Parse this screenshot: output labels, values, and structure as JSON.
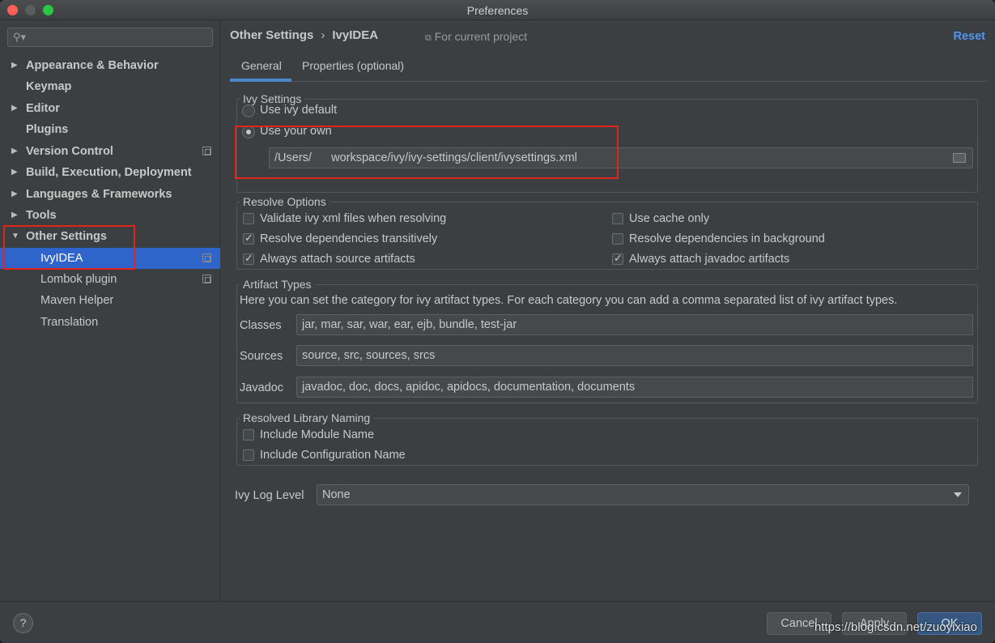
{
  "window": {
    "title": "Preferences"
  },
  "sidebar": {
    "search_placeholder": "",
    "items": [
      {
        "label": "Appearance & Behavior"
      },
      {
        "label": "Keymap"
      },
      {
        "label": "Editor"
      },
      {
        "label": "Plugins"
      },
      {
        "label": "Version Control"
      },
      {
        "label": "Build, Execution, Deployment"
      },
      {
        "label": "Languages & Frameworks"
      },
      {
        "label": "Tools"
      },
      {
        "label": "Other Settings"
      },
      {
        "label": "IvyIDEA"
      },
      {
        "label": "Lombok plugin"
      },
      {
        "label": "Maven Helper"
      },
      {
        "label": "Translation"
      }
    ]
  },
  "header": {
    "crumb_parent": "Other Settings",
    "crumb_sep": "›",
    "crumb_current": "IvyIDEA",
    "scope": "For current project",
    "reset": "Reset"
  },
  "tabs": [
    {
      "label": "General"
    },
    {
      "label": "Properties (optional)"
    }
  ],
  "ivy_settings": {
    "title": "Ivy Settings",
    "use_default": "Use ivy default",
    "use_own": "Use your own",
    "path": "/Users/   workspace/ivy/ivy-settings/client/ivysettings.xml"
  },
  "resolve_options": {
    "title": "Resolve Options",
    "validate": "Validate ivy xml files when resolving",
    "transitive": "Resolve dependencies transitively",
    "attach_source": "Always attach source artifacts",
    "cache_only": "Use cache only",
    "background": "Resolve dependencies in background",
    "attach_javadoc": "Always attach javadoc artifacts"
  },
  "artifact_types": {
    "title": "Artifact Types",
    "description": "Here you can set the category for ivy artifact types. For each category you can add a comma separated list of ivy artifact types.",
    "classes_label": "Classes",
    "classes_value": "jar, mar, sar, war, ear, ejb, bundle, test-jar",
    "sources_label": "Sources",
    "sources_value": "source, src, sources, srcs",
    "javadoc_label": "Javadoc",
    "javadoc_value": "javadoc, doc, docs, apidoc, apidocs, documentation, documents"
  },
  "library_naming": {
    "title": "Resolved Library Naming",
    "module": "Include Module Name",
    "configuration": "Include Configuration Name"
  },
  "log_level": {
    "label": "Ivy Log Level",
    "value": "None"
  },
  "footer": {
    "help": "?",
    "cancel": "Cancel",
    "apply": "Apply",
    "ok": "OK",
    "watermark": "https://blog.csdn.net/zuoyixiao"
  }
}
